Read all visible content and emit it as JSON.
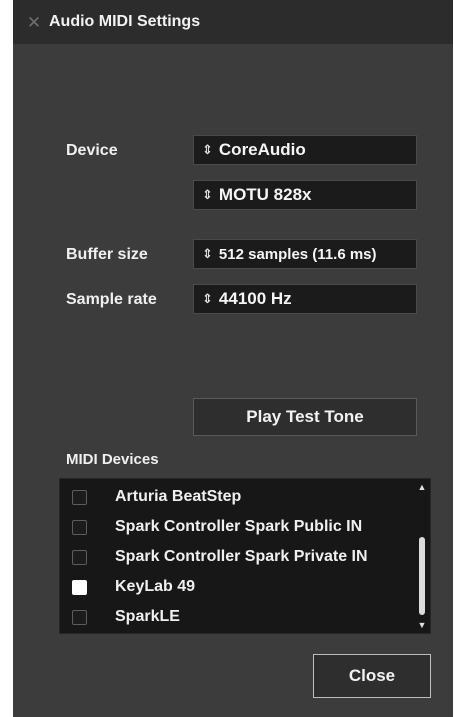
{
  "window": {
    "title": "Audio MIDI Settings",
    "close_icon": "✕"
  },
  "settings": {
    "device_label": "Device",
    "device_type": "CoreAudio",
    "device_name": "MOTU 828x",
    "buffer_label": "Buffer size",
    "buffer_value": "512 samples (11.6 ms)",
    "rate_label": "Sample rate",
    "rate_value": "44100 Hz",
    "select_arrows": "⇕"
  },
  "test_tone_button": "Play Test Tone",
  "midi": {
    "label": "MIDI Devices",
    "devices": [
      {
        "name": "Arturia BeatStep",
        "checked": false
      },
      {
        "name": "Spark Controller Spark Public IN",
        "checked": false
      },
      {
        "name": "Spark Controller Spark Private IN",
        "checked": false
      },
      {
        "name": "KeyLab 49",
        "checked": true
      },
      {
        "name": "SparkLE",
        "checked": false
      }
    ]
  },
  "close_button": "Close"
}
